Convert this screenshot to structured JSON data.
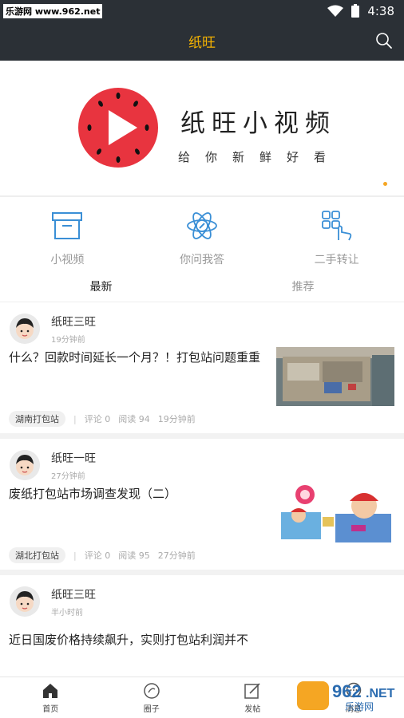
{
  "status_bar": {
    "watermark": "乐游网 www.962.net",
    "time": "4:38"
  },
  "header": {
    "title": "纸旺",
    "search_icon": "search-icon"
  },
  "banner": {
    "title": "纸旺小视频",
    "slogan": "给你新鲜好看",
    "logo_icon": "watermelon-play-icon"
  },
  "entries": [
    {
      "label": "小视频",
      "icon": "box-icon"
    },
    {
      "label": "你问我答",
      "icon": "atom-pen-icon"
    },
    {
      "label": "二手转让",
      "icon": "grid-hand-icon"
    }
  ],
  "tabs": [
    {
      "label": "最新",
      "active": true
    },
    {
      "label": "推荐",
      "active": false
    }
  ],
  "posts": [
    {
      "author": "纸旺三旺",
      "time": "19分钟前",
      "title": "什么？回款时间延长一个月？！打包站问题重重",
      "tag": "湖南打包站",
      "comments": "评论 0",
      "reads": "阅读 94",
      "posted": "19分钟前"
    },
    {
      "author": "纸旺一旺",
      "time": "27分钟前",
      "title": "废纸打包站市场调查发现（二）",
      "tag": "湖北打包站",
      "comments": "评论 0",
      "reads": "阅读 95",
      "posted": "27分钟前"
    },
    {
      "author": "纸旺三旺",
      "time": "半小时前",
      "title": "近日国废价格持续飙升，实则打包站利润并不"
    }
  ],
  "tabbar": [
    {
      "label": "首页",
      "icon": "home-icon"
    },
    {
      "label": "圈子",
      "icon": "circle-icon"
    },
    {
      "label": "发帖",
      "icon": "edit-icon"
    },
    {
      "label": "消息",
      "icon": "message-icon"
    }
  ],
  "watermark_bottom": "962.NET 乐游网",
  "colors": {
    "header_bg": "#2b3036",
    "accent": "#f5b301",
    "icon_blue": "#3a8fd6"
  }
}
